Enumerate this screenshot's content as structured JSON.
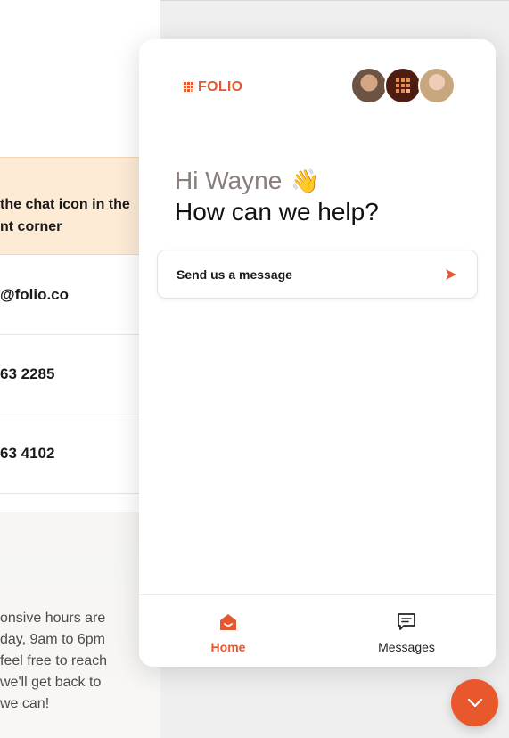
{
  "background": {
    "notice_lines": [
      "the chat icon in the",
      "nt corner"
    ],
    "contacts": [
      "@folio.co",
      "63 2285",
      "63 4102"
    ],
    "hours_lines": [
      "onsive hours are",
      "day, 9am to 6pm",
      "feel free to reach",
      "we'll get back to",
      "we can!"
    ]
  },
  "widget": {
    "logo_text": "FOLIO",
    "greeting": "Hi Wayne",
    "wave_emoji": "👋",
    "headline": "How can we help?",
    "send_message_label": "Send us a message",
    "nav": [
      {
        "label": "Home",
        "icon": "home-icon",
        "active": true
      },
      {
        "label": "Messages",
        "icon": "messages-icon",
        "active": false
      }
    ]
  },
  "colors": {
    "brand": "#e2582f",
    "greeting_muted": "#8a7d7a",
    "notice_bg": "#fdebd6"
  }
}
